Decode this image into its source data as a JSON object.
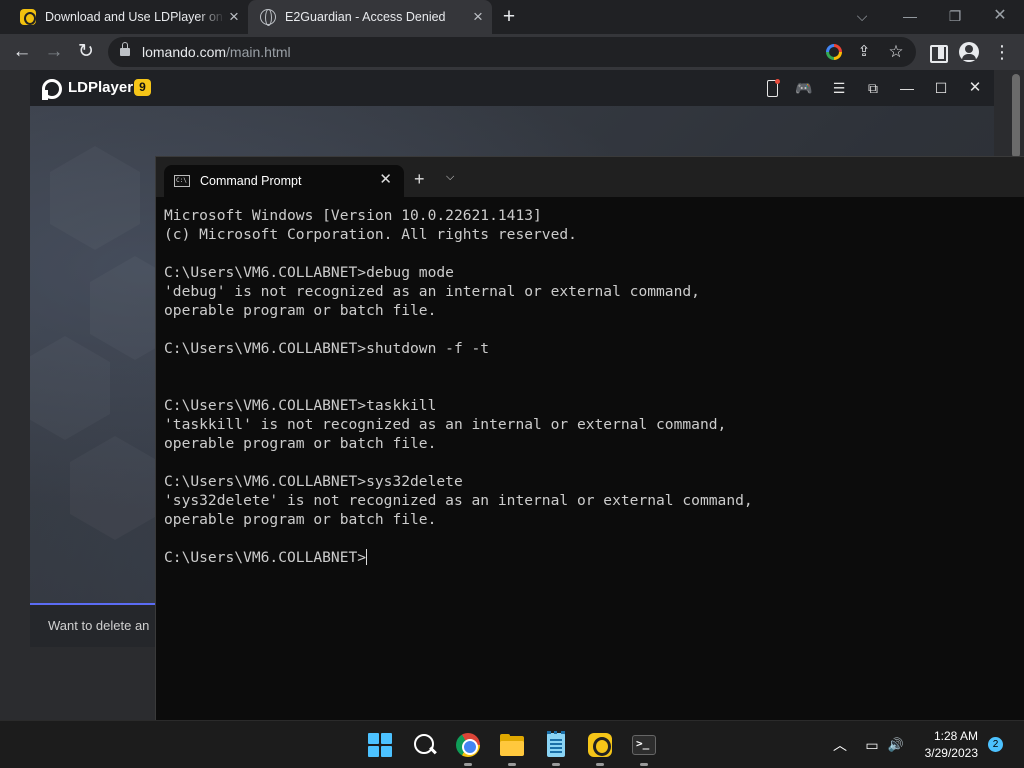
{
  "browser": {
    "tabs": [
      {
        "title": "Download and Use LDPlayer on PC",
        "icon": "ldplayer-favicon-icon"
      },
      {
        "title": "E2Guardian - Access Denied",
        "icon": "globe-favicon-icon"
      }
    ],
    "new_tab_glyph": "+",
    "controls": {
      "tab_search": "⌵",
      "minimize": "—",
      "restore": "❐",
      "close": "✕"
    },
    "nav": {
      "back": "←",
      "forward": "→",
      "reload": "↻"
    },
    "url": {
      "domain": "lomando.com",
      "path": "/main.html"
    },
    "omnibox_icons": {
      "share": "⇪",
      "bookmark": "☆"
    },
    "menu_glyph": "⋮"
  },
  "ldplayer": {
    "title": "LDPlayer",
    "version_badge": "9",
    "icons": {
      "gamepad": "🎮",
      "menu": "☰",
      "popout": "⧉",
      "minimize": "—",
      "maximize": "☐",
      "close": "✕"
    },
    "footer_text": "Want to delete an"
  },
  "terminal": {
    "tab_title": "Command Prompt",
    "tab_close": "✕",
    "new_tab": "+",
    "dropdown": "⌵",
    "lines": [
      "Microsoft Windows [Version 10.0.22621.1413]",
      "(c) Microsoft Corporation. All rights reserved.",
      "",
      "C:\\Users\\VM6.COLLABNET>debug mode",
      "'debug' is not recognized as an internal or external command,",
      "operable program or batch file.",
      "",
      "C:\\Users\\VM6.COLLABNET>shutdown -f -t",
      "",
      "",
      "C:\\Users\\VM6.COLLABNET>taskkill",
      "'taskkill' is not recognized as an internal or external command,",
      "operable program or batch file.",
      "",
      "C:\\Users\\VM6.COLLABNET>sys32delete",
      "'sys32delete' is not recognized as an internal or external command,",
      "operable program or batch file.",
      "",
      "C:\\Users\\VM6.COLLABNET>"
    ]
  },
  "taskbar": {
    "apps": [
      "start-icon",
      "search-icon",
      "chrome-icon",
      "file-explorer-icon",
      "notepad-icon",
      "ldplayer-icon",
      "terminal-icon"
    ],
    "tray": {
      "chevron": "︿",
      "display": "▭",
      "volume": "🔊"
    },
    "time": "1:28 AM",
    "date": "3/29/2023",
    "notification_count": "2"
  },
  "colors": {
    "accent_blue": "#4cc2ff",
    "ldplayer_yellow": "#f5c518",
    "terminal_bg": "#0c0c0c",
    "terminal_text": "#cccccc"
  }
}
